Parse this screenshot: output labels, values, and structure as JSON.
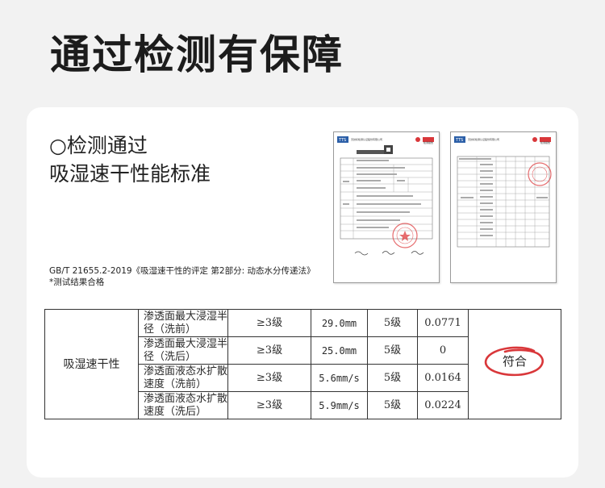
{
  "page_title": "通过检测有保障",
  "heading": {
    "line1": "○检测通过",
    "line2": "吸湿速干性能标准"
  },
  "standard_note": {
    "line1": "GB/T 21655.2-2019《吸湿速干性的评定 第2部分: 动态水分传递法》",
    "line2": "*测试结果合格"
  },
  "reports": [
    {
      "header": "天纺标检测认证股份有限公司",
      "badge_text": "检测报告"
    },
    {
      "header": "天纺标检测认证股份有限公司",
      "badge_text": "检测报告"
    }
  ],
  "table": {
    "item": "吸湿速干性",
    "result": "符合",
    "rows": [
      {
        "param": "渗透面最大浸湿半径（洗前）",
        "req": "≥3级",
        "value": "29.0mm",
        "grade": "5级",
        "extra": "0.0771"
      },
      {
        "param": "渗透面最大浸湿半径（洗后）",
        "req": "≥3级",
        "value": "25.0mm",
        "grade": "5级",
        "extra": "0"
      },
      {
        "param": "渗透面液态水扩散速度（洗前）",
        "req": "≥3级",
        "value": "5.6mm/s",
        "grade": "5级",
        "extra": "0.0164"
      },
      {
        "param": "渗透面液态水扩散速度（洗后）",
        "req": "≥3级",
        "value": "5.9mm/s",
        "grade": "5级",
        "extra": "0.0224"
      }
    ]
  },
  "colors": {
    "page_bg": "#f2f2f2",
    "card_bg": "#ffffff",
    "result_ring": "#d9373a",
    "stamp": "#e0474a",
    "logo_blue": "#2b5fa8"
  }
}
